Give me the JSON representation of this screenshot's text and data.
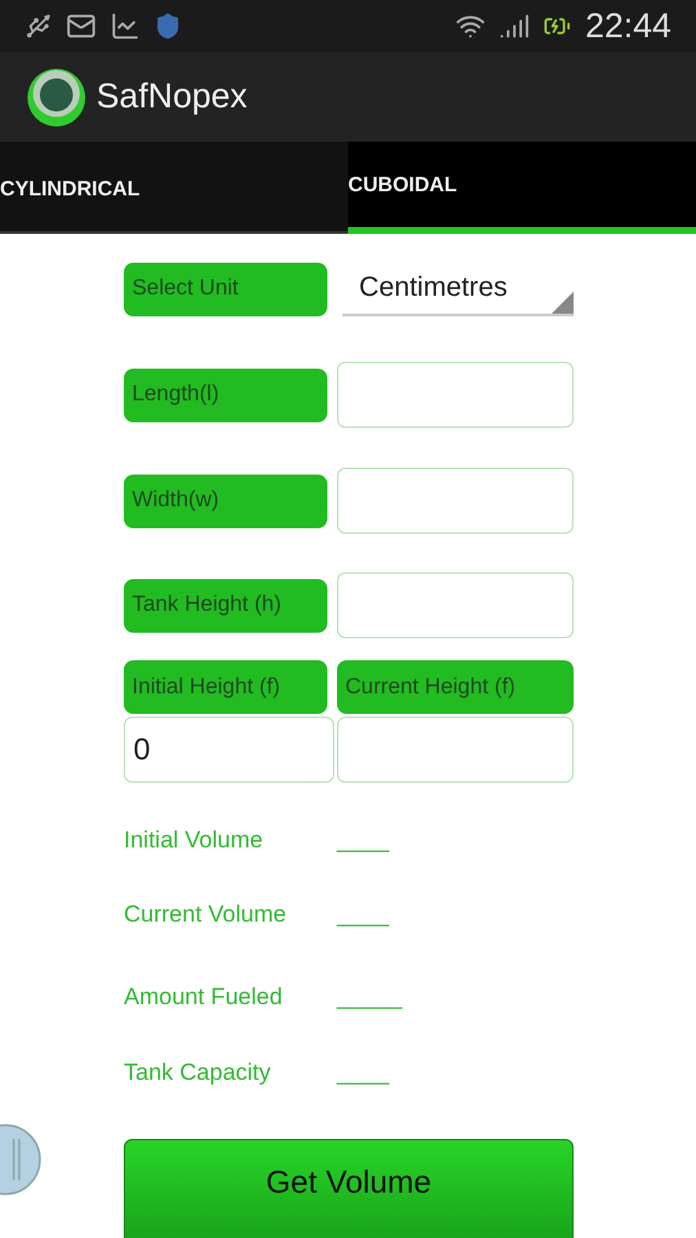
{
  "status_bar": {
    "time": "22:44"
  },
  "app_bar": {
    "title": "SafNopex"
  },
  "tabs": [
    {
      "label": "CYLINDRICAL",
      "selected": false
    },
    {
      "label": "CUBOIDAL",
      "selected": true
    }
  ],
  "unit": {
    "label": "Select Unit",
    "value": "Centimetres"
  },
  "fields": [
    {
      "label": "Length(l)"
    },
    {
      "label": "Width(w)"
    },
    {
      "label": "Tank Height (h)"
    }
  ],
  "heights": [
    {
      "label": "Initial Height (f)",
      "value": "0"
    },
    {
      "label": "Current Height (f)"
    }
  ],
  "results": [
    {
      "label": "Initial Volume",
      "value": "____"
    },
    {
      "label": "Current Volume",
      "value": "____"
    },
    {
      "label": "Amount Fueled",
      "value": "_____"
    },
    {
      "label": "Tank Capacity",
      "value": "____"
    }
  ],
  "button": "Get Volume"
}
